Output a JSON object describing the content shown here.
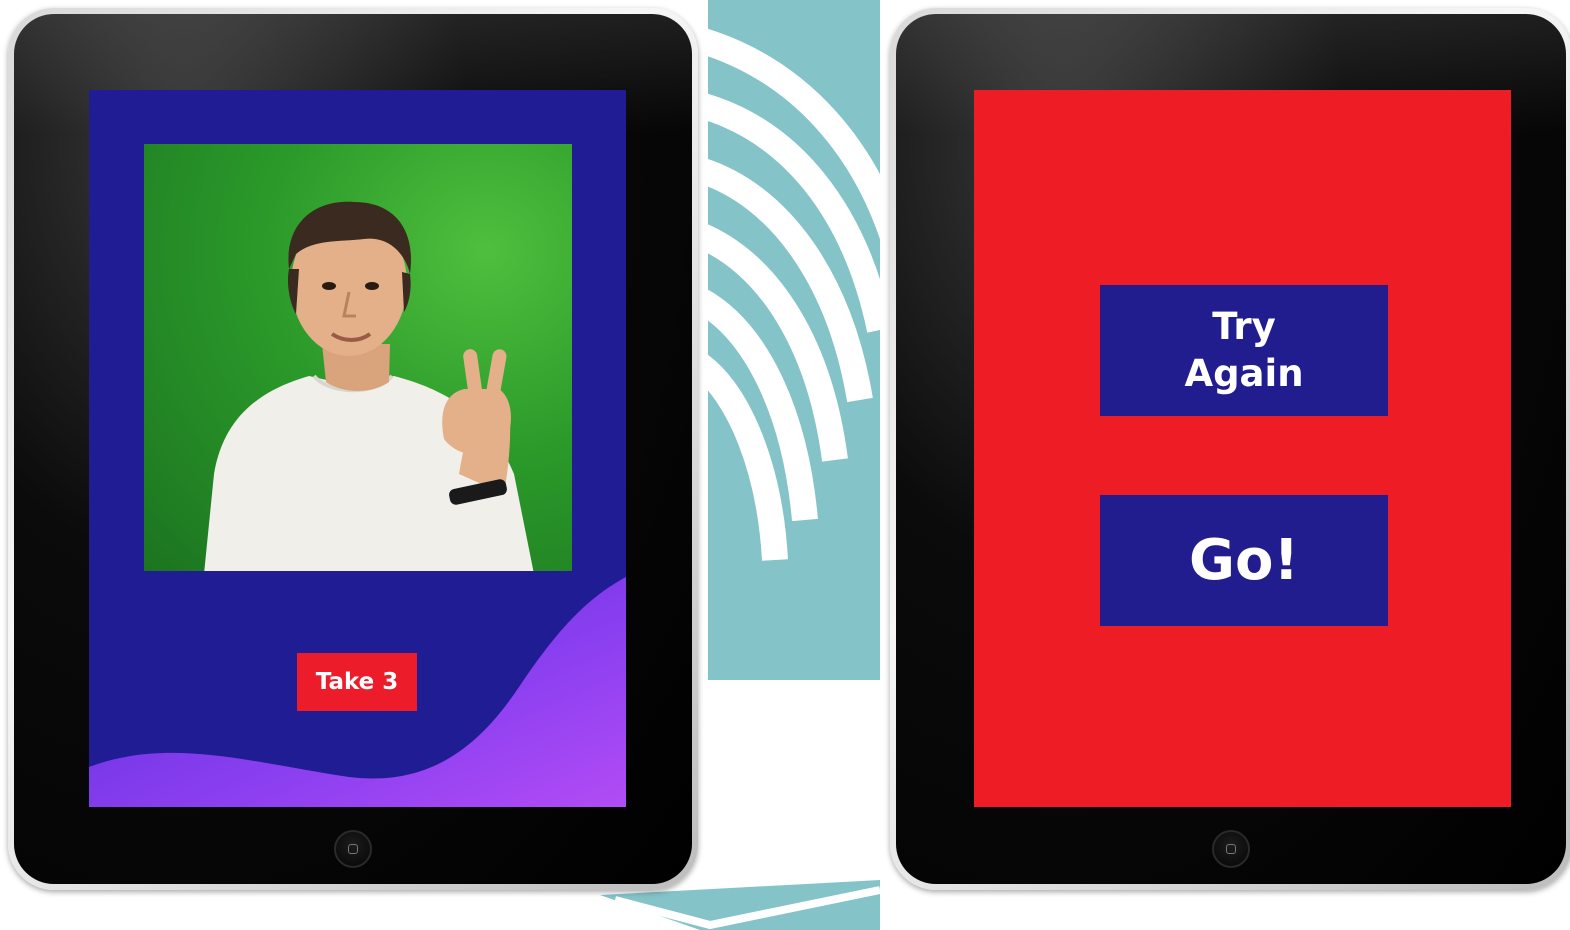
{
  "colors": {
    "screen_left_bg": "#201c93",
    "screen_right_bg": "#ee1c24",
    "button_blue": "#221d8f",
    "button_red": "#ec1c2a",
    "green_screen": "#2b9a2a",
    "wave_purple": "#7b3fe8",
    "teal_background": "#84c3c8"
  },
  "left_screen": {
    "photo_alt": "",
    "take_button_label": "Take 3"
  },
  "right_screen": {
    "try_again_line1": "Try",
    "try_again_line2": "Again",
    "go_label": "Go!"
  }
}
